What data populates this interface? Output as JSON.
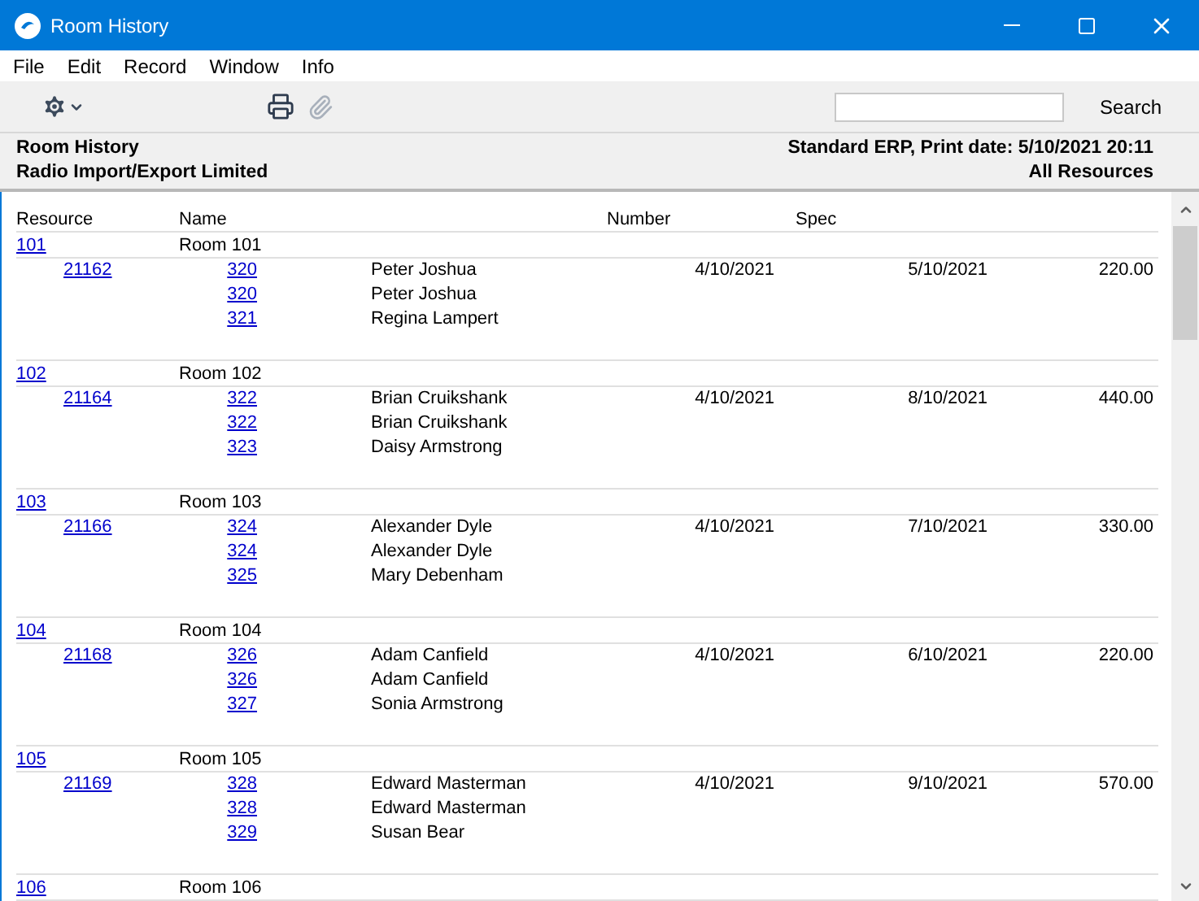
{
  "window": {
    "title": "Room History"
  },
  "menu": [
    "File",
    "Edit",
    "Record",
    "Window",
    "Info"
  ],
  "toolbar": {
    "search_button": "Search"
  },
  "report_header": {
    "title": "Room History",
    "company": "Radio Import/Export Limited",
    "system": "Standard ERP, Print date: 5/10/2021 20:11",
    "selection": "All Resources"
  },
  "columns": [
    "Resource",
    "Name",
    "Number",
    "Spec"
  ],
  "groups": [
    {
      "resource": "101",
      "name": "Room 101",
      "reservations": [
        {
          "number": "21162",
          "date_from": "4/10/2021",
          "date_to": "5/10/2021",
          "amount": "220.00",
          "guests": [
            {
              "code": "320",
              "name": "Peter Joshua"
            },
            {
              "code": "320",
              "name": "Peter Joshua"
            },
            {
              "code": "321",
              "name": "Regina Lampert"
            }
          ]
        }
      ]
    },
    {
      "resource": "102",
      "name": "Room 102",
      "reservations": [
        {
          "number": "21164",
          "date_from": "4/10/2021",
          "date_to": "8/10/2021",
          "amount": "440.00",
          "guests": [
            {
              "code": "322",
              "name": "Brian Cruikshank"
            },
            {
              "code": "322",
              "name": "Brian Cruikshank"
            },
            {
              "code": "323",
              "name": "Daisy Armstrong"
            }
          ]
        }
      ]
    },
    {
      "resource": "103",
      "name": "Room 103",
      "reservations": [
        {
          "number": "21166",
          "date_from": "4/10/2021",
          "date_to": "7/10/2021",
          "amount": "330.00",
          "guests": [
            {
              "code": "324",
              "name": "Alexander Dyle"
            },
            {
              "code": "324",
              "name": "Alexander Dyle"
            },
            {
              "code": "325",
              "name": "Mary Debenham"
            }
          ]
        }
      ]
    },
    {
      "resource": "104",
      "name": "Room 104",
      "reservations": [
        {
          "number": "21168",
          "date_from": "4/10/2021",
          "date_to": "6/10/2021",
          "amount": "220.00",
          "guests": [
            {
              "code": "326",
              "name": "Adam Canfield"
            },
            {
              "code": "326",
              "name": "Adam Canfield"
            },
            {
              "code": "327",
              "name": "Sonia Armstrong"
            }
          ]
        }
      ]
    },
    {
      "resource": "105",
      "name": "Room 105",
      "reservations": [
        {
          "number": "21169",
          "date_from": "4/10/2021",
          "date_to": "9/10/2021",
          "amount": "570.00",
          "guests": [
            {
              "code": "328",
              "name": "Edward Masterman"
            },
            {
              "code": "328",
              "name": "Edward Masterman"
            },
            {
              "code": "329",
              "name": "Susan Bear"
            }
          ]
        }
      ]
    },
    {
      "resource": "106",
      "name": "Room 106"
    }
  ]
}
